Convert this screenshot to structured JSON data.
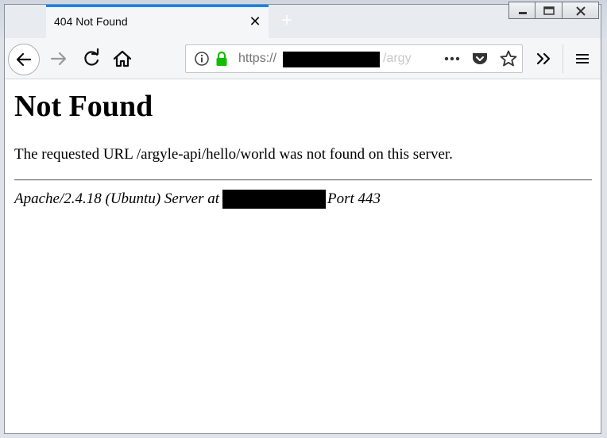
{
  "tab": {
    "title": "404 Not Found",
    "close_glyph": "✕",
    "new_tab_glyph": "+"
  },
  "urlbar": {
    "scheme": "https://",
    "path_fragment": "/argy"
  },
  "icons": {
    "back": "arrow-left-icon",
    "forward": "arrow-right-icon",
    "reload": "reload-icon",
    "home": "home-icon",
    "info": "info-icon",
    "lock": "lock-icon",
    "page_actions": "ellipsis-icon",
    "pocket": "pocket-icon",
    "bookmark": "star-icon",
    "overflow": "double-chevron-icon",
    "menu": "hamburger-icon"
  },
  "colors": {
    "tab_accent": "#0a84ff",
    "lock": "#12bc00"
  },
  "page": {
    "heading": "Not Found",
    "message": "The requested URL /argyle-api/hello/world was not found on this server.",
    "footer_prefix": "Apache/2.4.18 (Ubuntu) Server at",
    "footer_suffix": "Port 443"
  }
}
